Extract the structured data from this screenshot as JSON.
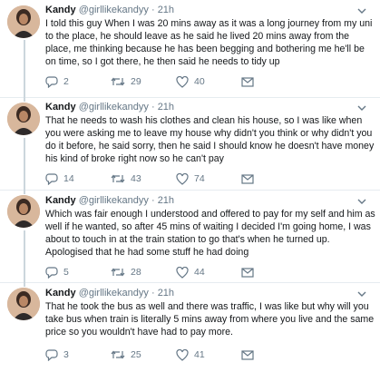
{
  "author": {
    "name": "Kandy",
    "handle": "@girllikekandyy",
    "separator": "·",
    "time": "21h"
  },
  "colors": {
    "text": "#14171a",
    "muted": "#657786",
    "divider": "#e6ecf0",
    "thread_line": "#ccd6dd"
  },
  "icons": {
    "reply": "speech-bubble",
    "retweet": "retweet-arrows",
    "like": "heart-outline",
    "dm": "envelope",
    "more": "chevron-down"
  },
  "tweets": [
    {
      "text": "I told this guy When I was 20 mins away as it was a long journey from my uni to the place, he should leave as he said he lived 20 mins away from the place, me thinking because he has been begging and bothering me he'll be on time, so I got there, he then said he needs to tidy up",
      "replies": "2",
      "retweets": "29",
      "likes": "40"
    },
    {
      "text": "That he needs to wash his clothes and clean his house, so I was like when you were asking me to leave my house why didn't you think or why didn't you do it before, he said sorry, then he said I should know he doesn't have money his kind of broke right now so he can't pay",
      "replies": "14",
      "retweets": "43",
      "likes": "74"
    },
    {
      "text": "Which was fair enough I understood and offered to pay for my self and him as well if he wanted, so after 45 mins of waiting I decided I'm going home, I was about to touch in at the train station to go that's when he turned up. Apologised that he had some stuff he had doing",
      "replies": "5",
      "retweets": "28",
      "likes": "44"
    },
    {
      "text": "That he took the bus as well and there was traffic, I was like but why will you take bus when train is literally 5 mins away from where you live and the same price so you wouldn't have had to pay more.",
      "replies": "3",
      "retweets": "25",
      "likes": "41"
    }
  ]
}
